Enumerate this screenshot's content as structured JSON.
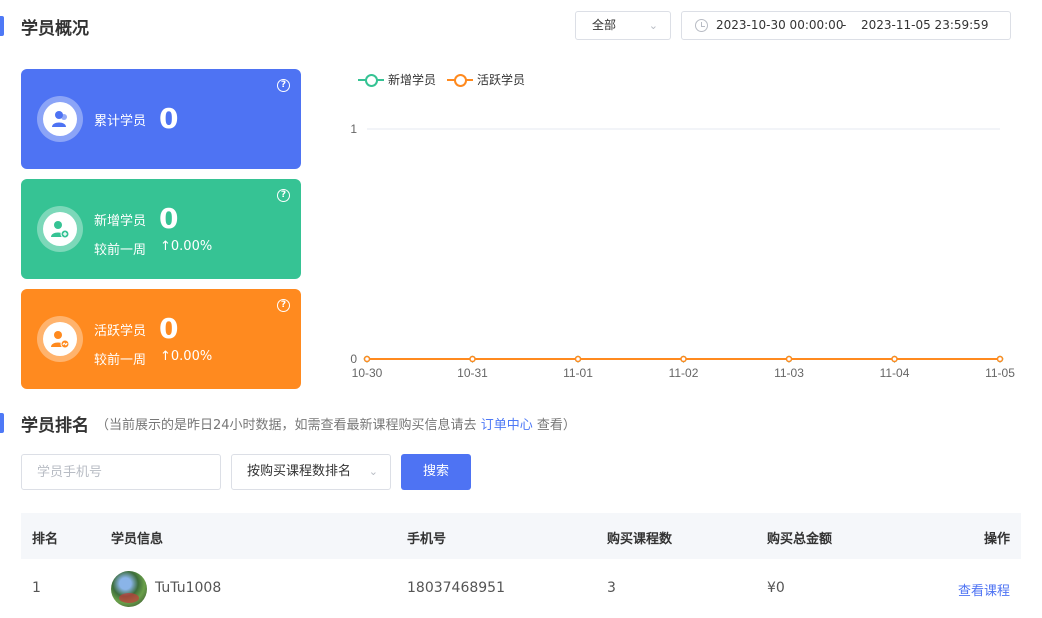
{
  "overview": {
    "title": "学员概况",
    "filter_value": "全部",
    "date_start": "2023-10-30 00:00:00",
    "date_sep": "-",
    "date_end": "2023-11-05 23:59:59"
  },
  "cards": [
    {
      "label": "累计学员",
      "value": "0",
      "color": "#4e73f3",
      "icon": "user-total-icon"
    },
    {
      "label": "新增学员",
      "value": "0",
      "compare_label": "较前一周",
      "compare_value": "0.00%",
      "color": "#36c394",
      "icon": "user-add-icon"
    },
    {
      "label": "活跃学员",
      "value": "0",
      "compare_label": "较前一周",
      "compare_value": "0.00%",
      "color": "#ff8a1f",
      "icon": "user-active-icon"
    }
  ],
  "card_help": "?",
  "card_arrow": "↑",
  "chart_data": {
    "type": "line",
    "x": [
      "10-30",
      "10-31",
      "11-01",
      "11-02",
      "11-03",
      "11-04",
      "11-05"
    ],
    "series": [
      {
        "name": "新增学员",
        "values": [
          0,
          0,
          0,
          0,
          0,
          0,
          0
        ],
        "color": "#36c394"
      },
      {
        "name": "活跃学员",
        "values": [
          0,
          0,
          0,
          0,
          0,
          0,
          0
        ],
        "color": "#ff8a1f"
      }
    ],
    "ylim": [
      0,
      1
    ],
    "yticks": [
      "0",
      "1"
    ],
    "legend": "top-left"
  },
  "ranking": {
    "title": "学员排名",
    "note_prefix": "（当前展示的是昨日24小时数据，如需查看最新课程购买信息请去",
    "note_link": "订单中心",
    "note_suffix": "查看）",
    "phone_placeholder": "学员手机号",
    "sort_value": "按购买课程数排名",
    "search_label": "搜索",
    "columns": [
      "排名",
      "学员信息",
      "手机号",
      "购买课程数",
      "购买总金额",
      "操作"
    ],
    "rows": [
      {
        "rank": "1",
        "name": "TuTu1008",
        "phone": "18037468951",
        "courses": "3",
        "amount": "¥0",
        "action": "查看课程"
      }
    ]
  }
}
